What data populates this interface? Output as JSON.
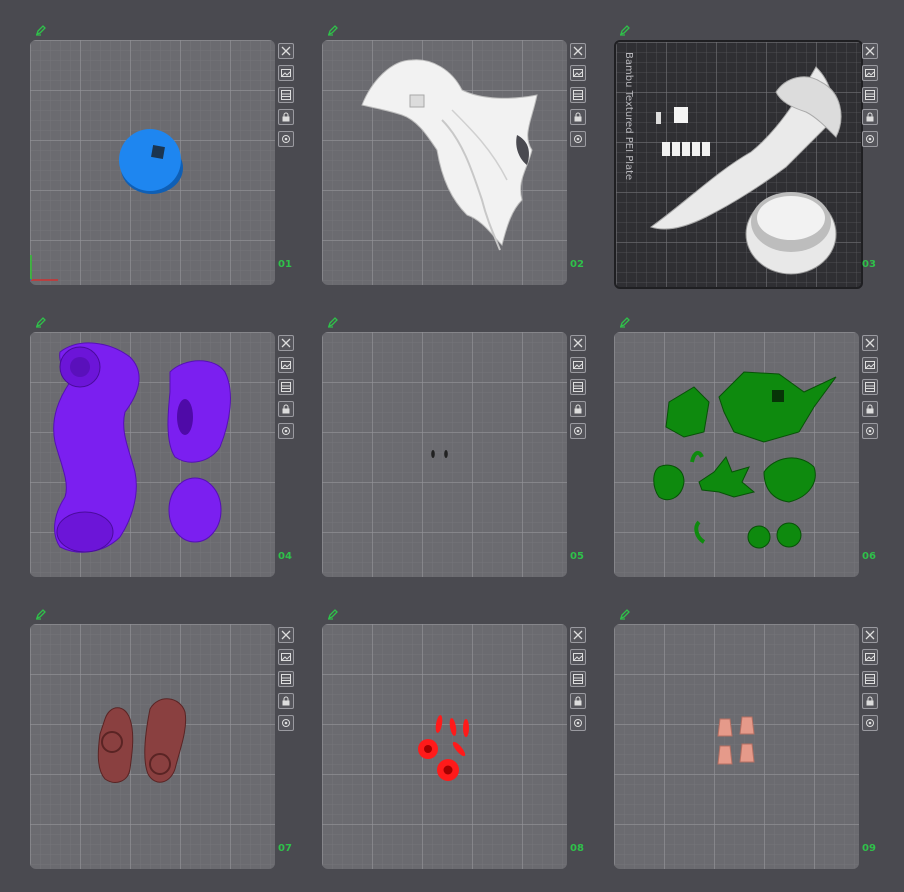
{
  "plates": [
    {
      "number": "01",
      "model_color": "#1e86f0"
    },
    {
      "number": "02",
      "model_color": "#f2f2f2"
    },
    {
      "number": "03",
      "model_color": "#e8e8e8",
      "plate_label": "Bambu Textured PEI Plate"
    },
    {
      "number": "04",
      "model_color": "#7b1ff0"
    },
    {
      "number": "05",
      "model_color": "#222222"
    },
    {
      "number": "06",
      "model_color": "#0e8a0e"
    },
    {
      "number": "07",
      "model_color": "#8a4040"
    },
    {
      "number": "08",
      "model_color": "#ff1a1a"
    },
    {
      "number": "09",
      "model_color": "#e59a8a"
    }
  ],
  "toolbar_icons": [
    "close-icon",
    "image-icon",
    "layout-icon",
    "lock-icon",
    "settings-icon"
  ],
  "accent_color": "#2fc24a"
}
